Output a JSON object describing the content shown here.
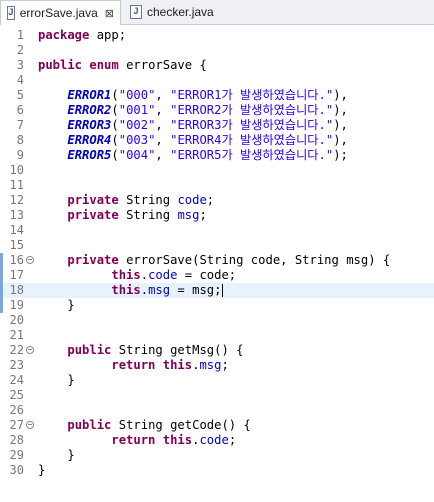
{
  "tabs": [
    {
      "icon": "J",
      "label": "errorSave.java",
      "close": "⊠",
      "active": true
    },
    {
      "icon": "J",
      "label": "checker.java",
      "active": false
    }
  ],
  "lines": [
    {
      "n": "1",
      "segs": [
        {
          "t": "kw",
          "v": "package"
        },
        {
          "t": "",
          "v": " app;"
        }
      ]
    },
    {
      "n": "2",
      "segs": []
    },
    {
      "n": "3",
      "segs": [
        {
          "t": "kw",
          "v": "public"
        },
        {
          "t": "",
          "v": " "
        },
        {
          "t": "kw",
          "v": "enum"
        },
        {
          "t": "",
          "v": " errorSave {"
        }
      ]
    },
    {
      "n": "4",
      "segs": []
    },
    {
      "n": "5",
      "segs": [
        {
          "t": "",
          "v": "    "
        },
        {
          "t": "en",
          "v": "ERROR1"
        },
        {
          "t": "",
          "v": "("
        },
        {
          "t": "str",
          "v": "\"000\""
        },
        {
          "t": "",
          "v": ", "
        },
        {
          "t": "str",
          "v": "\"ERROR1가 발생하였습니다.\""
        },
        {
          "t": "",
          "v": "),"
        }
      ]
    },
    {
      "n": "6",
      "segs": [
        {
          "t": "",
          "v": "    "
        },
        {
          "t": "en",
          "v": "ERROR2"
        },
        {
          "t": "",
          "v": "("
        },
        {
          "t": "str",
          "v": "\"001\""
        },
        {
          "t": "",
          "v": ", "
        },
        {
          "t": "str",
          "v": "\"ERROR2가 발생하였습니다.\""
        },
        {
          "t": "",
          "v": "),"
        }
      ]
    },
    {
      "n": "7",
      "segs": [
        {
          "t": "",
          "v": "    "
        },
        {
          "t": "en",
          "v": "ERROR3"
        },
        {
          "t": "",
          "v": "("
        },
        {
          "t": "str",
          "v": "\"002\""
        },
        {
          "t": "",
          "v": ", "
        },
        {
          "t": "str",
          "v": "\"ERROR3가 발생하였습니다.\""
        },
        {
          "t": "",
          "v": "),"
        }
      ]
    },
    {
      "n": "8",
      "segs": [
        {
          "t": "",
          "v": "    "
        },
        {
          "t": "en",
          "v": "ERROR4"
        },
        {
          "t": "",
          "v": "("
        },
        {
          "t": "str",
          "v": "\"003\""
        },
        {
          "t": "",
          "v": ", "
        },
        {
          "t": "str",
          "v": "\"ERROR4가 발생하였습니다.\""
        },
        {
          "t": "",
          "v": "),"
        }
      ]
    },
    {
      "n": "9",
      "segs": [
        {
          "t": "",
          "v": "    "
        },
        {
          "t": "en",
          "v": "ERROR5"
        },
        {
          "t": "",
          "v": "("
        },
        {
          "t": "str",
          "v": "\"004\""
        },
        {
          "t": "",
          "v": ", "
        },
        {
          "t": "str",
          "v": "\"ERROR5가 발생하였습니다.\""
        },
        {
          "t": "",
          "v": ");"
        }
      ]
    },
    {
      "n": "10",
      "segs": []
    },
    {
      "n": "11",
      "segs": []
    },
    {
      "n": "12",
      "segs": [
        {
          "t": "",
          "v": "    "
        },
        {
          "t": "kw",
          "v": "private"
        },
        {
          "t": "",
          "v": " String "
        },
        {
          "t": "fld",
          "v": "code"
        },
        {
          "t": "",
          "v": ";"
        }
      ]
    },
    {
      "n": "13",
      "segs": [
        {
          "t": "",
          "v": "    "
        },
        {
          "t": "kw",
          "v": "private"
        },
        {
          "t": "",
          "v": " String "
        },
        {
          "t": "fld",
          "v": "msg"
        },
        {
          "t": "",
          "v": ";"
        }
      ]
    },
    {
      "n": "14",
      "segs": []
    },
    {
      "n": "15",
      "segs": []
    },
    {
      "n": "16",
      "fold": true,
      "segs": [
        {
          "t": "",
          "v": "    "
        },
        {
          "t": "kw",
          "v": "private"
        },
        {
          "t": "",
          "v": " errorSave(String code, String msg) {"
        }
      ]
    },
    {
      "n": "17",
      "segs": [
        {
          "t": "",
          "v": "          "
        },
        {
          "t": "kw",
          "v": "this"
        },
        {
          "t": "",
          "v": "."
        },
        {
          "t": "fld",
          "v": "code"
        },
        {
          "t": "",
          "v": " = code;"
        }
      ]
    },
    {
      "n": "18",
      "current": true,
      "caret": true,
      "segs": [
        {
          "t": "",
          "v": "          "
        },
        {
          "t": "kw",
          "v": "this"
        },
        {
          "t": "",
          "v": "."
        },
        {
          "t": "fld",
          "v": "msg"
        },
        {
          "t": "",
          "v": " = msg;"
        }
      ]
    },
    {
      "n": "19",
      "segs": [
        {
          "t": "",
          "v": "    }"
        }
      ]
    },
    {
      "n": "20",
      "segs": []
    },
    {
      "n": "21",
      "segs": []
    },
    {
      "n": "22",
      "fold": true,
      "segs": [
        {
          "t": "",
          "v": "    "
        },
        {
          "t": "kw",
          "v": "public"
        },
        {
          "t": "",
          "v": " String getMsg() {"
        }
      ]
    },
    {
      "n": "23",
      "segs": [
        {
          "t": "",
          "v": "          "
        },
        {
          "t": "kw",
          "v": "return"
        },
        {
          "t": "",
          "v": " "
        },
        {
          "t": "kw",
          "v": "this"
        },
        {
          "t": "",
          "v": "."
        },
        {
          "t": "fld",
          "v": "msg"
        },
        {
          "t": "",
          "v": ";"
        }
      ]
    },
    {
      "n": "24",
      "segs": [
        {
          "t": "",
          "v": "    }"
        }
      ]
    },
    {
      "n": "25",
      "segs": []
    },
    {
      "n": "26",
      "segs": []
    },
    {
      "n": "27",
      "fold": true,
      "segs": [
        {
          "t": "",
          "v": "    "
        },
        {
          "t": "kw",
          "v": "public"
        },
        {
          "t": "",
          "v": " String getCode() {"
        }
      ]
    },
    {
      "n": "28",
      "segs": [
        {
          "t": "",
          "v": "          "
        },
        {
          "t": "kw",
          "v": "return"
        },
        {
          "t": "",
          "v": " "
        },
        {
          "t": "kw",
          "v": "this"
        },
        {
          "t": "",
          "v": "."
        },
        {
          "t": "fld",
          "v": "code"
        },
        {
          "t": "",
          "v": ";"
        }
      ]
    },
    {
      "n": "29",
      "segs": [
        {
          "t": "",
          "v": "    }"
        }
      ]
    },
    {
      "n": "30",
      "segs": [
        {
          "t": "",
          "v": "}"
        }
      ]
    }
  ]
}
